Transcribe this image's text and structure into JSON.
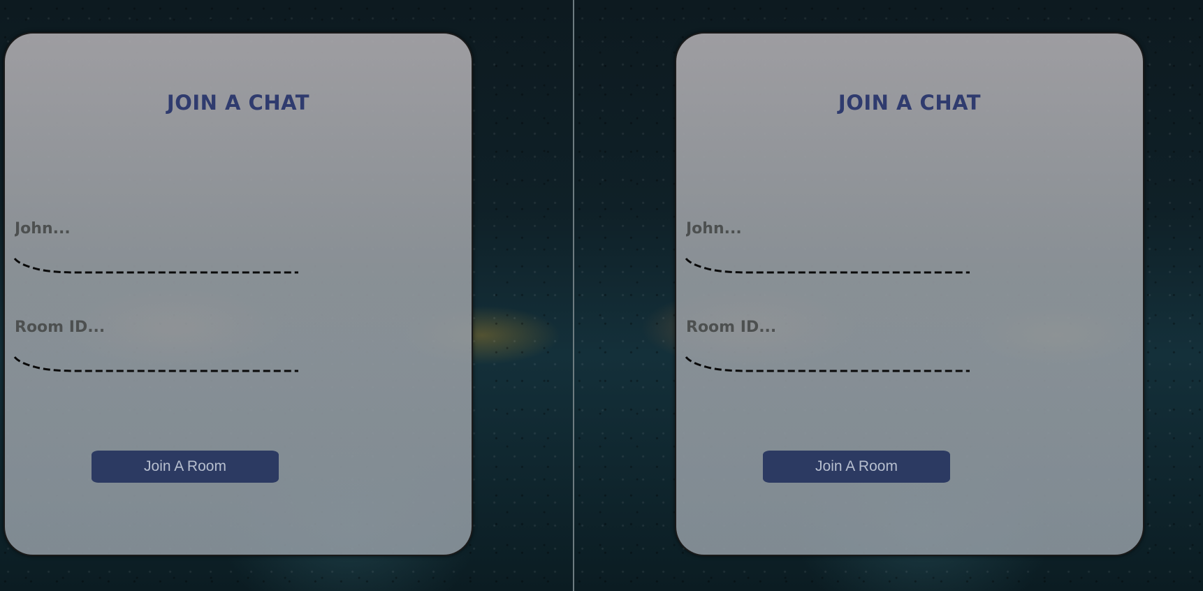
{
  "panels": [
    {
      "title": "JOIN A CHAT",
      "name_field": {
        "placeholder": "John...",
        "value": ""
      },
      "room_field": {
        "placeholder": "Room ID...",
        "value": ""
      },
      "join_button_label": "Join A Room"
    },
    {
      "title": "JOIN A CHAT",
      "name_field": {
        "placeholder": "John...",
        "value": ""
      },
      "room_field": {
        "placeholder": "Room ID...",
        "value": ""
      },
      "join_button_label": "Join A Room"
    }
  ],
  "colors": {
    "title": "#2f3b6e",
    "button_bg": "#2c3a62",
    "button_text": "#b7bfcf",
    "card_bg": "#a7a8ab",
    "underline": "#0a0a0a"
  }
}
